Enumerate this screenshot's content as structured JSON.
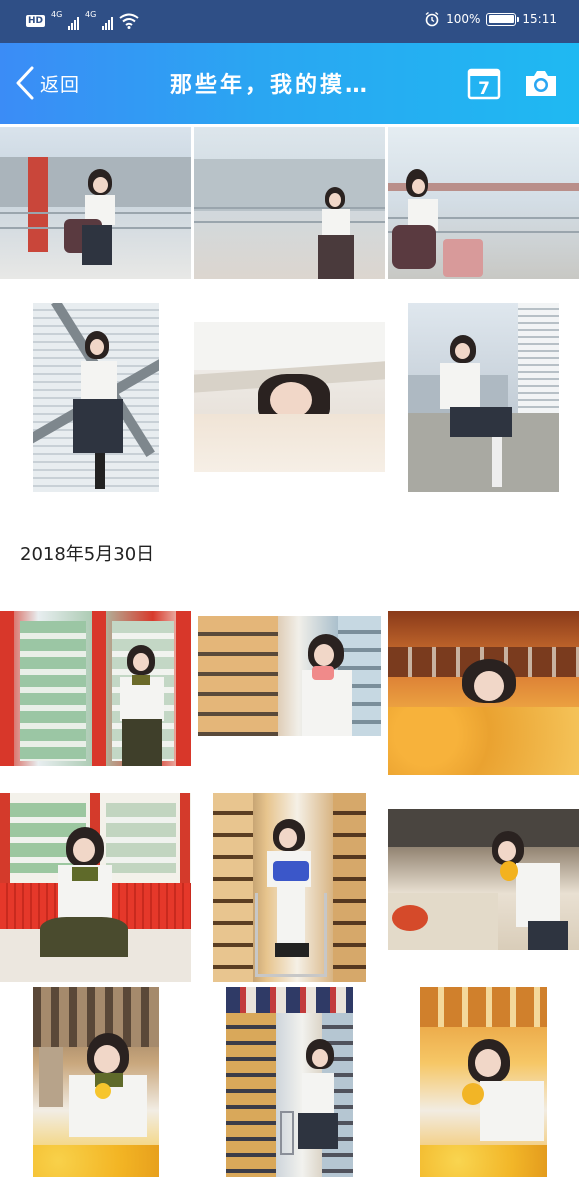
{
  "status_bar": {
    "hd": "HD",
    "network1": "4G",
    "network2": "4G",
    "battery_percent": "100%",
    "battery_level": 1.0,
    "time": "15:11",
    "icons": [
      "hd-icon",
      "signal-icon",
      "signal-icon",
      "wifi-icon",
      "alarm-icon",
      "battery-icon"
    ]
  },
  "app_bar": {
    "back_label": "返回",
    "title": "那些年，我的摸…",
    "calendar_day": "7",
    "icons": [
      "back-arrow-icon",
      "calendar-icon",
      "camera-icon"
    ]
  },
  "gallery": {
    "sections": [
      {
        "date_label": "2018年5月30日"
      }
    ]
  },
  "colors": {
    "status_bar": "#2f4f86",
    "app_bar_start": "#3b8cf6",
    "app_bar_end": "#1fb9f2",
    "background": "#ffffff",
    "date_text": "#222222"
  }
}
